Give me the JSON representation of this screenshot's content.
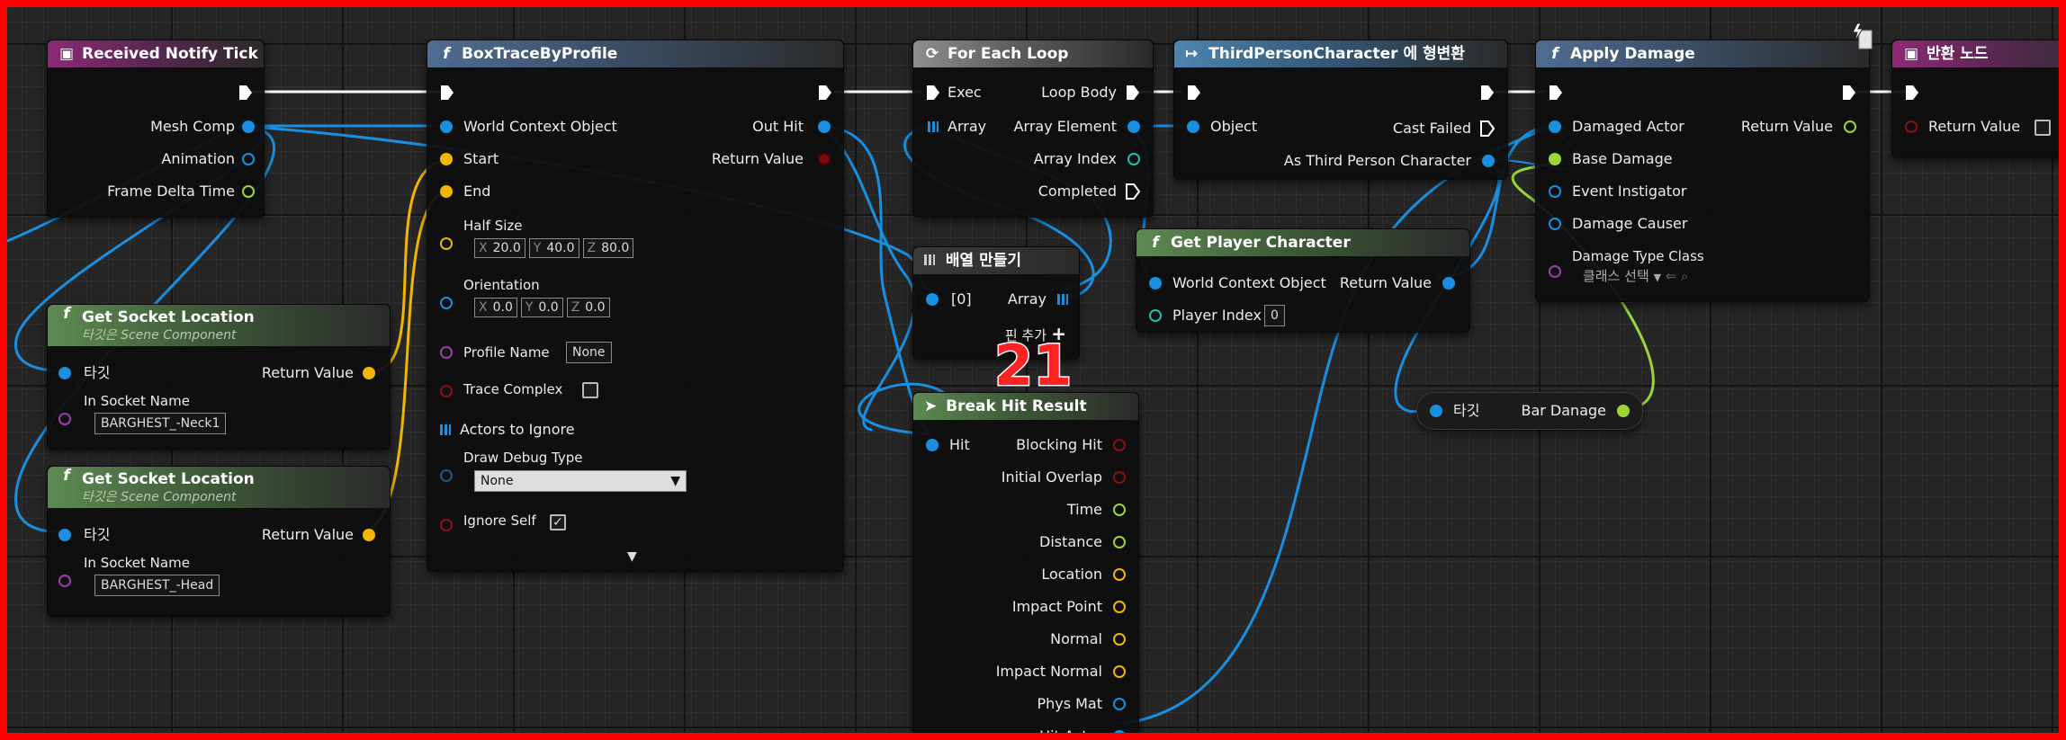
{
  "colors": {
    "frame": "#ff0000",
    "exec": "#ffffff",
    "object": "#1a8fe0",
    "vector": "#f2b600",
    "float": "#9ad638",
    "bool": "#8a1010",
    "class": "#9b3fb0",
    "badge": "#ff2222"
  },
  "badge": "21",
  "nodes": {
    "received_notify_tick": {
      "icon": "event-icon",
      "title": "Received Notify Tick",
      "pins": {
        "mesh_comp": "Mesh Comp",
        "animation": "Animation",
        "frame_delta_time": "Frame Delta Time"
      }
    },
    "socket1": {
      "icon": "f",
      "title": "Get Socket Location",
      "subtitle": "타깃은 Scene Component",
      "target": "타깃",
      "return_value": "Return Value",
      "in_socket_name": "In Socket Name",
      "socket_value": "BARGHEST_-Neck1"
    },
    "socket2": {
      "icon": "f",
      "title": "Get Socket Location",
      "subtitle": "타깃은 Scene Component",
      "target": "타깃",
      "return_value": "Return Value",
      "in_socket_name": "In Socket Name",
      "socket_value": "BARGHEST_-Head"
    },
    "box_trace": {
      "icon": "f",
      "title": "BoxTraceByProfile",
      "world_context": "World Context Object",
      "start": "Start",
      "end": "End",
      "half_size": "Half Size",
      "half_size_values": {
        "x": "20.0",
        "y": "40.0",
        "z": "80.0"
      },
      "orientation": "Orientation",
      "orientation_values": {
        "x": "0.0",
        "y": "0.0",
        "z": "0.0"
      },
      "profile_name": "Profile Name",
      "profile_value": "None",
      "trace_complex": "Trace Complex",
      "actors_to_ignore": "Actors to Ignore",
      "draw_debug_type": "Draw Debug Type",
      "draw_debug_value": "None",
      "ignore_self": "Ignore Self",
      "out_hit": "Out Hit",
      "return_value": "Return Value"
    },
    "for_each": {
      "title": "For Each Loop",
      "exec": "Exec",
      "array": "Array",
      "loop_body": "Loop Body",
      "array_element": "Array Element",
      "array_index": "Array Index",
      "completed": "Completed"
    },
    "make_array": {
      "title": "배열 만들기",
      "item0": "[0]",
      "array": "Array",
      "add_pin": "핀 추가"
    },
    "break_hit": {
      "title": "Break Hit Result",
      "hit": "Hit",
      "outputs": [
        "Blocking Hit",
        "Initial Overlap",
        "Time",
        "Distance",
        "Location",
        "Impact Point",
        "Normal",
        "Impact Normal",
        "Phys Mat",
        "Hit Actor"
      ]
    },
    "cast": {
      "title": "ThirdPersonCharacter 에 형변환",
      "object": "Object",
      "cast_failed": "Cast Failed",
      "as_character": "As Third Person Character"
    },
    "get_player": {
      "title": "Get Player Character",
      "world_context": "World Context Object",
      "return_value": "Return Value",
      "player_index": "Player Index",
      "player_index_value": "0"
    },
    "apply_damage": {
      "title": "Apply Damage",
      "damaged_actor": "Damaged Actor",
      "base_damage": "Base Damage",
      "event_instigator": "Event Instigator",
      "damage_causer": "Damage Causer",
      "damage_type_class": "Damage Type Class",
      "class_select": "클래스 선택",
      "return_value": "Return Value"
    },
    "bar_damage": {
      "target": "타깃",
      "label": "Bar Danage"
    },
    "return_node": {
      "title": "반환 노드",
      "return_value": "Return Value"
    }
  }
}
